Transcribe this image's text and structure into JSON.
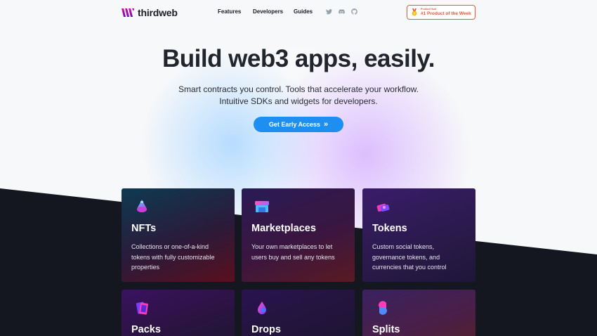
{
  "header": {
    "brand": "thirdweb",
    "nav": [
      {
        "label": "Features"
      },
      {
        "label": "Developers"
      },
      {
        "label": "Guides"
      }
    ],
    "social_icons": [
      "twitter-icon",
      "discord-icon",
      "github-icon"
    ],
    "badge": {
      "small": "Product Hunt",
      "big": "#1 Product of the Week"
    }
  },
  "hero": {
    "title": "Build web3 apps, easily.",
    "subtitle_line1": "Smart contracts you control. Tools that accelerate your workflow.",
    "subtitle_line2": "Intuitive SDKs and widgets for developers.",
    "cta_label": "Get Early Access",
    "cta_icon": "»"
  },
  "colors": {
    "accent": "#1e8ff0",
    "dark": "#151720",
    "badge": "#e8573d"
  },
  "cards": [
    {
      "title": "NFTs",
      "desc": "Collections or one-of-a-kind tokens with fully customizable properties",
      "icon": "nft-drop-icon"
    },
    {
      "title": "Marketplaces",
      "desc": "Your own marketplaces to let users buy and sell any tokens",
      "icon": "store-icon"
    },
    {
      "title": "Tokens",
      "desc": "Custom social tokens, governance tokens, and currencies that you control",
      "icon": "token-cards-icon"
    },
    {
      "title": "Packs",
      "desc": "",
      "icon": "pack-icon"
    },
    {
      "title": "Drops",
      "desc": "",
      "icon": "drop-icon"
    },
    {
      "title": "Splits",
      "desc": "",
      "icon": "split-icon"
    }
  ]
}
